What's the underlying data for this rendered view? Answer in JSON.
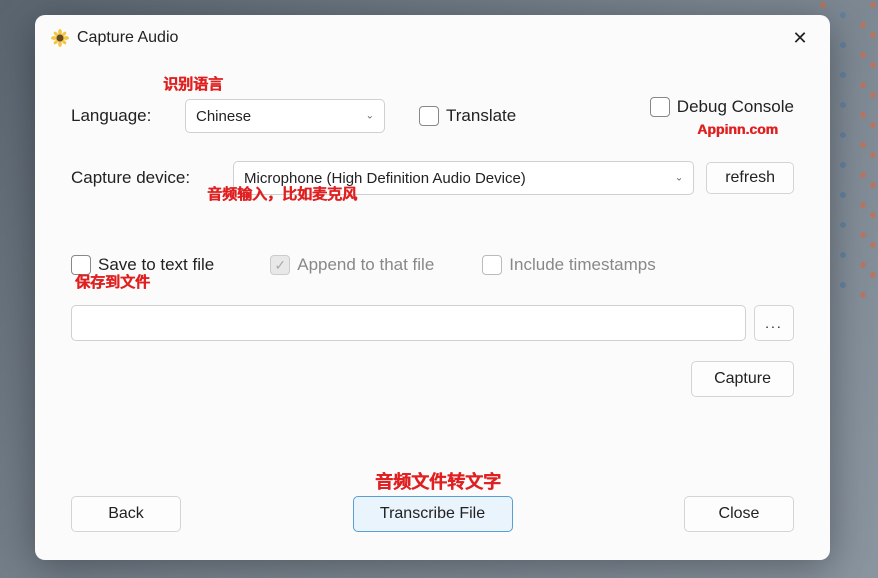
{
  "titlebar": {
    "title": "Capture Audio"
  },
  "topright": {
    "debug_console": "Debug Console"
  },
  "language": {
    "label": "Language:",
    "value": "Chinese",
    "translate": "Translate"
  },
  "device": {
    "label": "Capture device:",
    "value": "Microphone (High Definition Audio Device)",
    "refresh": "refresh"
  },
  "save": {
    "save_to_file": "Save to text file",
    "append": "Append to that file",
    "timestamps": "Include timestamps",
    "browse": "..."
  },
  "capture_btn": "Capture",
  "footer": {
    "back": "Back",
    "transcribe": "Transcribe File",
    "close": "Close"
  },
  "annotations": {
    "lang": "识别语言",
    "appinn": "Appinn.com",
    "audio_input": "音频输入，比如麦克风",
    "save_file": "保存到文件",
    "audio_to_text": "音频文件转文字"
  }
}
